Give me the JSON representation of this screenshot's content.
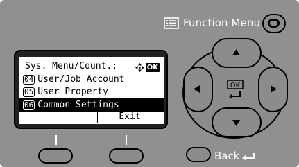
{
  "function_menu": {
    "label": "Function Menu"
  },
  "display": {
    "title": "Sys. Menu/Count.:",
    "ok_badge": "OK",
    "items": [
      {
        "number": "04",
        "label": "User/Job Account"
      },
      {
        "number": "05",
        "label": "User Property"
      },
      {
        "number": "06",
        "label": "Common Settings"
      }
    ],
    "selected_index": 2,
    "softkey_right": "Exit"
  },
  "ok_key": {
    "label": "OK"
  },
  "back": {
    "label": "Back"
  }
}
